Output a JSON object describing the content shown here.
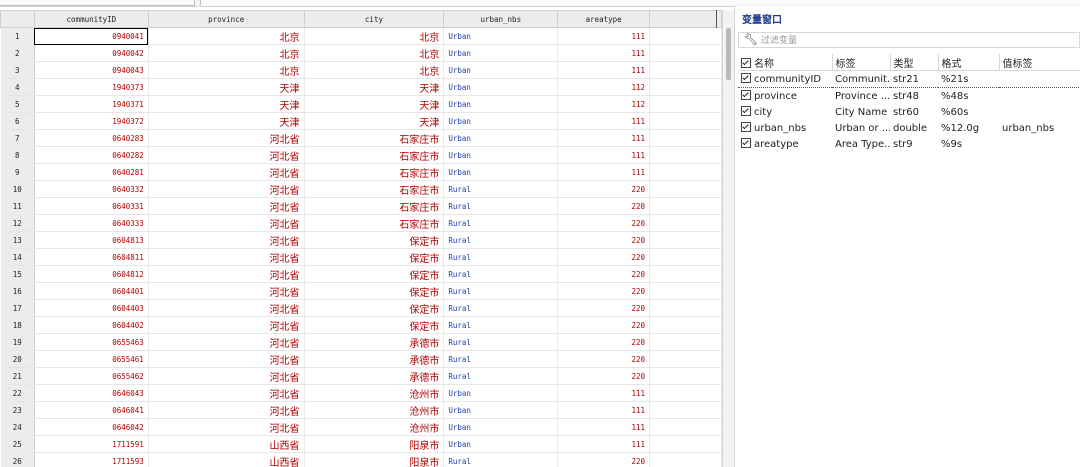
{
  "grid": {
    "columns": [
      "communityID",
      "province",
      "city",
      "urban_nbs",
      "areatype"
    ],
    "rows": [
      {
        "n": "1",
        "id": "0940041",
        "province": "北京",
        "city": "北京",
        "urban": "Urban",
        "area": "111"
      },
      {
        "n": "2",
        "id": "0940042",
        "province": "北京",
        "city": "北京",
        "urban": "Urban",
        "area": "111"
      },
      {
        "n": "3",
        "id": "0940043",
        "province": "北京",
        "city": "北京",
        "urban": "Urban",
        "area": "111"
      },
      {
        "n": "4",
        "id": "1940373",
        "province": "天津",
        "city": "天津",
        "urban": "Urban",
        "area": "112"
      },
      {
        "n": "5",
        "id": "1940371",
        "province": "天津",
        "city": "天津",
        "urban": "Urban",
        "area": "112"
      },
      {
        "n": "6",
        "id": "1940372",
        "province": "天津",
        "city": "天津",
        "urban": "Urban",
        "area": "111"
      },
      {
        "n": "7",
        "id": "0640283",
        "province": "河北省",
        "city": "石家庄市",
        "urban": "Urban",
        "area": "111"
      },
      {
        "n": "8",
        "id": "0640282",
        "province": "河北省",
        "city": "石家庄市",
        "urban": "Urban",
        "area": "111"
      },
      {
        "n": "9",
        "id": "0640281",
        "province": "河北省",
        "city": "石家庄市",
        "urban": "Urban",
        "area": "111"
      },
      {
        "n": "10",
        "id": "0640332",
        "province": "河北省",
        "city": "石家庄市",
        "urban": "Rural",
        "area": "220"
      },
      {
        "n": "11",
        "id": "0640331",
        "province": "河北省",
        "city": "石家庄市",
        "urban": "Rural",
        "area": "220"
      },
      {
        "n": "12",
        "id": "0640333",
        "province": "河北省",
        "city": "石家庄市",
        "urban": "Rural",
        "area": "220"
      },
      {
        "n": "13",
        "id": "0604813",
        "province": "河北省",
        "city": "保定市",
        "urban": "Rural",
        "area": "220"
      },
      {
        "n": "14",
        "id": "0604811",
        "province": "河北省",
        "city": "保定市",
        "urban": "Rural",
        "area": "220"
      },
      {
        "n": "15",
        "id": "0604812",
        "province": "河北省",
        "city": "保定市",
        "urban": "Rural",
        "area": "220"
      },
      {
        "n": "16",
        "id": "0604401",
        "province": "河北省",
        "city": "保定市",
        "urban": "Rural",
        "area": "220"
      },
      {
        "n": "17",
        "id": "0604403",
        "province": "河北省",
        "city": "保定市",
        "urban": "Rural",
        "area": "220"
      },
      {
        "n": "18",
        "id": "0604402",
        "province": "河北省",
        "city": "保定市",
        "urban": "Rural",
        "area": "220"
      },
      {
        "n": "19",
        "id": "0655463",
        "province": "河北省",
        "city": "承德市",
        "urban": "Rural",
        "area": "220"
      },
      {
        "n": "20",
        "id": "0655461",
        "province": "河北省",
        "city": "承德市",
        "urban": "Rural",
        "area": "220"
      },
      {
        "n": "21",
        "id": "0655462",
        "province": "河北省",
        "city": "承德市",
        "urban": "Rural",
        "area": "220"
      },
      {
        "n": "22",
        "id": "0646043",
        "province": "河北省",
        "city": "沧州市",
        "urban": "Urban",
        "area": "111"
      },
      {
        "n": "23",
        "id": "0646041",
        "province": "河北省",
        "city": "沧州市",
        "urban": "Urban",
        "area": "111"
      },
      {
        "n": "24",
        "id": "0646042",
        "province": "河北省",
        "city": "沧州市",
        "urban": "Urban",
        "area": "111"
      },
      {
        "n": "25",
        "id": "1711591",
        "province": "山西省",
        "city": "阳泉市",
        "urban": "Urban",
        "area": "111"
      },
      {
        "n": "26",
        "id": "1711593",
        "province": "山西省",
        "city": "阳泉市",
        "urban": "Rural",
        "area": "220"
      }
    ]
  },
  "panel": {
    "title": "变量窗口",
    "filter_placeholder": "过滤变量",
    "headers": [
      "名称",
      "标签",
      "类型",
      "格式",
      "值标签"
    ],
    "vars": [
      {
        "name": "communityID",
        "label": "Communit...",
        "type": "str21",
        "format": "%21s",
        "vlabel": ""
      },
      {
        "name": "province",
        "label": "Province ...",
        "type": "str48",
        "format": "%48s",
        "vlabel": ""
      },
      {
        "name": "city",
        "label": "City Name",
        "type": "str60",
        "format": "%60s",
        "vlabel": ""
      },
      {
        "name": "urban_nbs",
        "label": "Urban or ...",
        "type": "double",
        "format": "%12.0g",
        "vlabel": "urban_nbs"
      },
      {
        "name": "areatype",
        "label": "Area Type...",
        "type": "str9",
        "format": "%9s",
        "vlabel": ""
      }
    ]
  },
  "colors": {
    "string": "#b30000",
    "labeled": "#1f3fae",
    "header_bg": "#ececec",
    "panel_title": "#1b3a8a"
  },
  "icons": {
    "filter": "wrench-icon",
    "checkbox": "checkbox-checked-icon"
  }
}
